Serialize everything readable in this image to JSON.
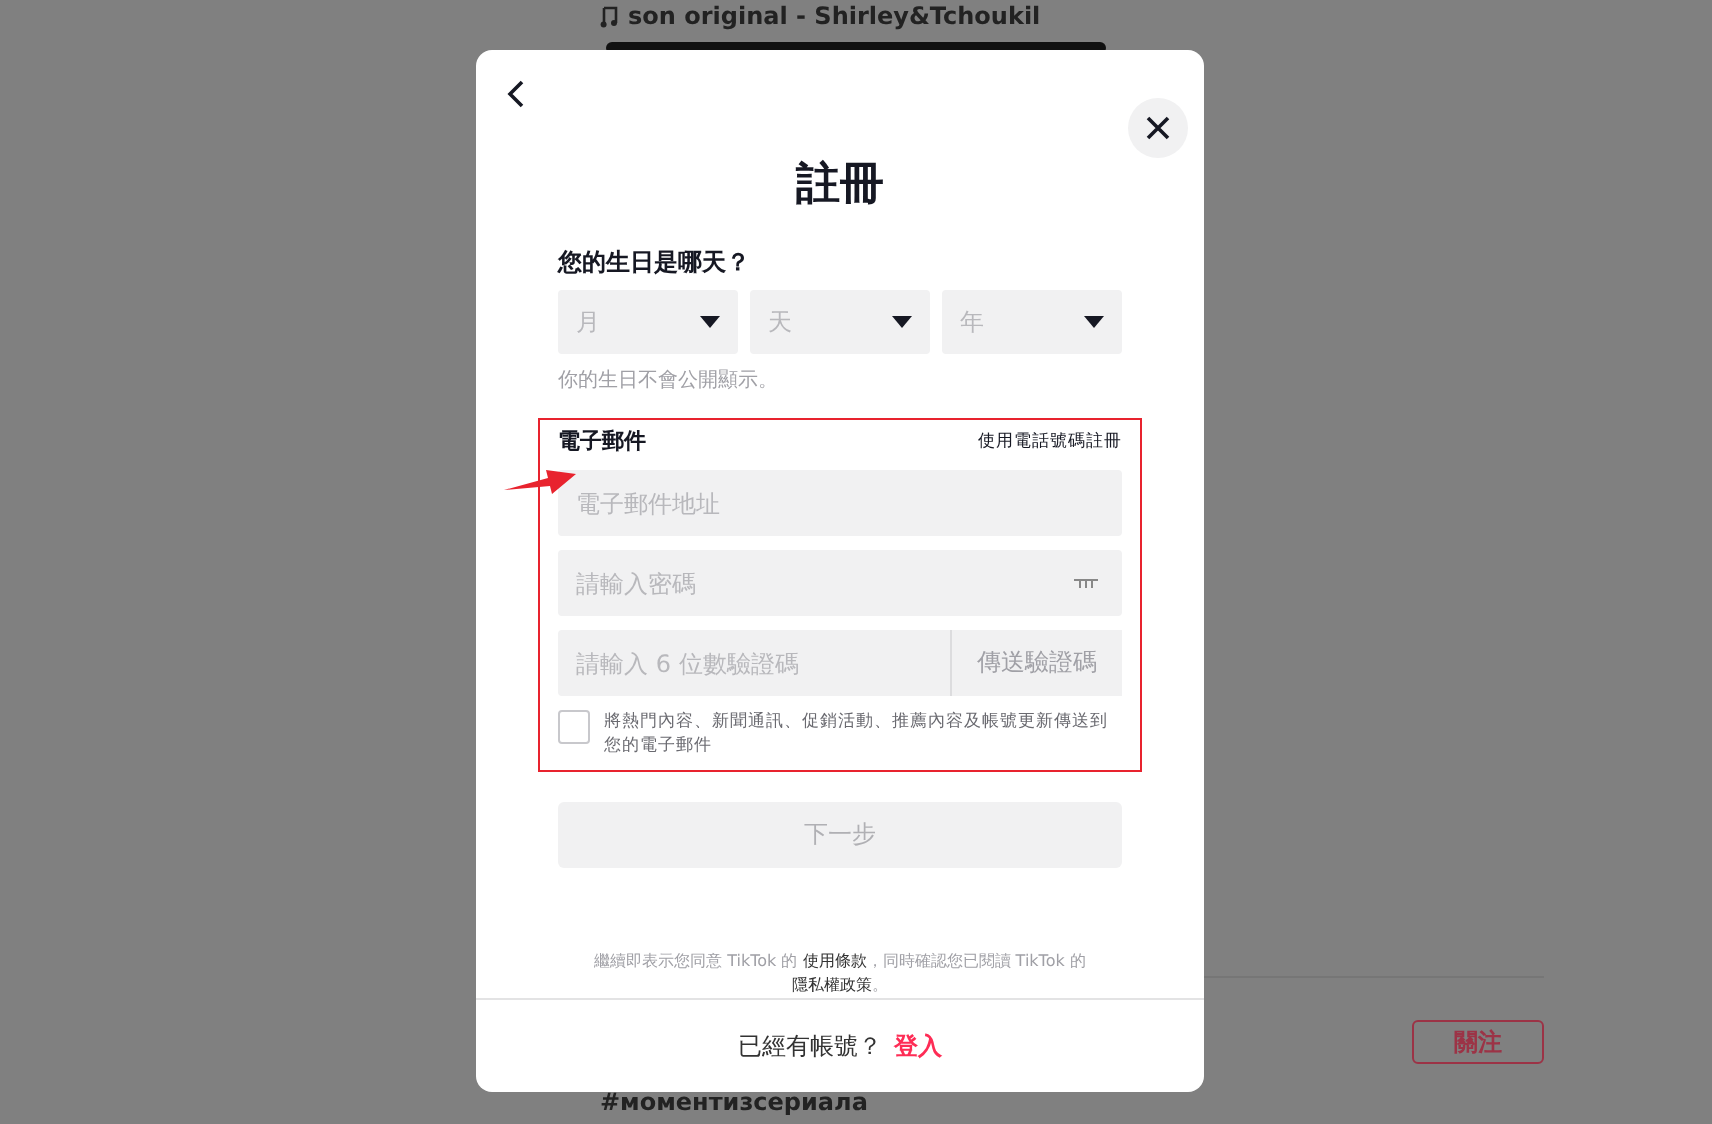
{
  "background": {
    "song": "son original - Shirley&Tchoukil",
    "hashtag": "#моментизсериала",
    "follow_button": "關注"
  },
  "dialog": {
    "title": "註冊",
    "birthday_label": "您的生日是哪天？",
    "birthday_selects": [
      {
        "placeholder": "月"
      },
      {
        "placeholder": "天"
      },
      {
        "placeholder": "年"
      }
    ],
    "birthday_hint": "你的生日不會公開顯示。",
    "email_label": "電子郵件",
    "phone_link": "使用電話號碼註冊",
    "email_field": {
      "placeholder": "電子郵件地址"
    },
    "password_field": {
      "placeholder": "請輸入密碼"
    },
    "code_field": {
      "placeholder": "請輸入 6 位數驗證碼"
    },
    "send_code_button": "傳送驗證碼",
    "newsletter": {
      "label": "將熱門內容、新聞通訊、促銷活動、推薦內容及帳號更新傳送到您的電子郵件",
      "checked": false
    },
    "next_button": {
      "label": "下一步",
      "disabled": true
    },
    "terms": "繼續即表示您同意 TikTok 的 **使用條款**，同時確認您已閱讀 TikTok 的**隱私權政策**。",
    "footer_text": "已經有帳號？",
    "login_link": "登入"
  }
}
